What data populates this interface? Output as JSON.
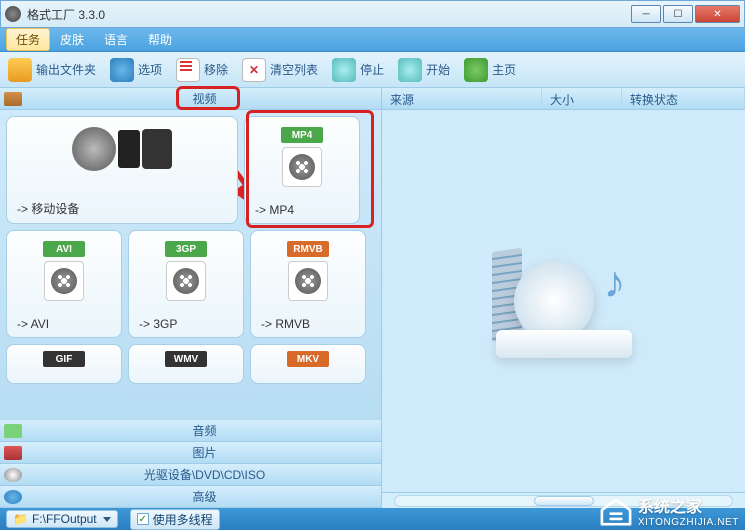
{
  "window": {
    "title": "格式工厂 3.3.0"
  },
  "menu": {
    "task": "任务",
    "skin": "皮肤",
    "language": "语言",
    "help": "帮助"
  },
  "toolbar": {
    "output_folder": "输出文件夹",
    "options": "选项",
    "remove": "移除",
    "clear_list": "清空列表",
    "stop": "停止",
    "start": "开始",
    "homepage": "主页"
  },
  "categories": {
    "video": "视频",
    "audio": "音频",
    "image": "图片",
    "disc": "光驱设备\\DVD\\CD\\ISO",
    "advanced": "高级"
  },
  "tiles": {
    "mobile": "-> 移动设备",
    "mp4_badge": "MP4",
    "mp4": "-> MP4",
    "avi_badge": "AVI",
    "avi": "-> AVI",
    "gp3_badge": "3GP",
    "gp3": "-> 3GP",
    "rmvb_badge": "RMVB",
    "rmvb": "-> RMVB",
    "gif_badge": "GIF",
    "wmv_badge": "WMV",
    "mkv_badge": "MKV"
  },
  "list": {
    "source": "来源",
    "size": "大小",
    "status": "转换状态"
  },
  "status": {
    "output_path": "F:\\FFOutput",
    "multithread": "使用多线程"
  },
  "watermark": {
    "title": "系统之家",
    "sub": "XITONGZHIJIA.NET"
  }
}
